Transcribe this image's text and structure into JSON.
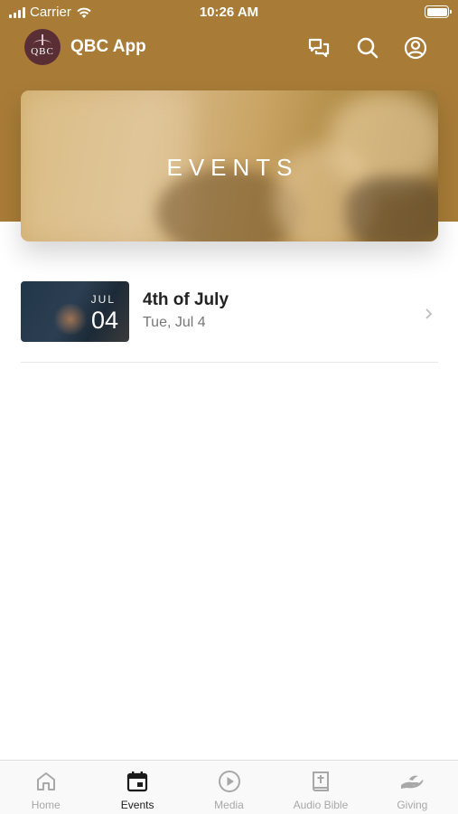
{
  "status_bar": {
    "carrier": "Carrier",
    "time": "10:26 AM"
  },
  "app": {
    "title": "QBC App",
    "logo_text": "QBC"
  },
  "header_icons": [
    "chat-icon",
    "search-icon",
    "profile-icon"
  ],
  "banner": {
    "title": "EVENTS"
  },
  "events": [
    {
      "title": "4th of July",
      "date": "Tue, Jul 4",
      "month": "JUL",
      "day": "04"
    }
  ],
  "tabs": [
    {
      "label": "Home",
      "icon": "home-icon",
      "active": false
    },
    {
      "label": "Events",
      "icon": "calendar-icon",
      "active": true
    },
    {
      "label": "Media",
      "icon": "play-icon",
      "active": false
    },
    {
      "label": "Audio Bible",
      "icon": "bible-icon",
      "active": false
    },
    {
      "label": "Giving",
      "icon": "giving-hand-icon",
      "active": false
    }
  ],
  "colors": {
    "header": "#a87c37",
    "active_tab": "#1b1b1b",
    "inactive_tab": "#a8a8a8"
  }
}
